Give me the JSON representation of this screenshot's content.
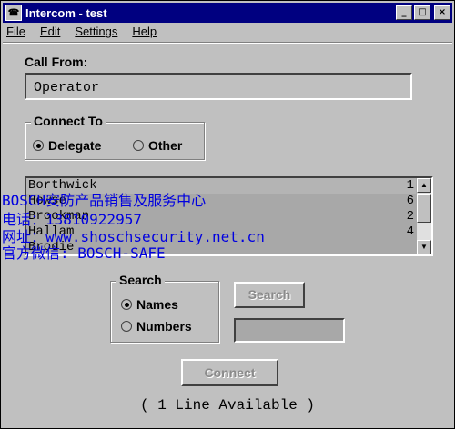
{
  "window": {
    "title": "Intercom - test",
    "app_icon": "intercom-icon",
    "controls": {
      "minimize": "_",
      "maximize": "□",
      "close": "×"
    }
  },
  "menu": [
    "File",
    "Edit",
    "Settings",
    "Help"
  ],
  "call_from": {
    "label": "Call From:",
    "value": "Operator"
  },
  "connect_to": {
    "label": "Connect To",
    "options": [
      "Delegate",
      "Other"
    ],
    "selected": "Delegate"
  },
  "list": {
    "rows": [
      {
        "name": "Borthwick",
        "num": "1"
      },
      {
        "name": "Howse",
        "num": "6"
      },
      {
        "name": "Brookman",
        "num": "2"
      },
      {
        "name": "Hallam",
        "num": "4"
      },
      {
        "name": "Brodie",
        "num": ""
      }
    ],
    "scroll_up": "▲",
    "scroll_down": "▼"
  },
  "search": {
    "label": "Search",
    "options": [
      "Names",
      "Numbers"
    ],
    "selected": "Names",
    "button": "Search",
    "value": ""
  },
  "connect_button": "Connect",
  "status": "( 1 Line Available )",
  "watermark": {
    "line1": "BOSCH安防产品销售及服务中心",
    "line2": "电话：13810922957",
    "line3": "网址：www.shoschsecurity.net.cn",
    "line4": "官方微信: BOSCH-SAFE"
  },
  "colors": {
    "title_bar": "#000080",
    "watermark": "#0000e0"
  }
}
